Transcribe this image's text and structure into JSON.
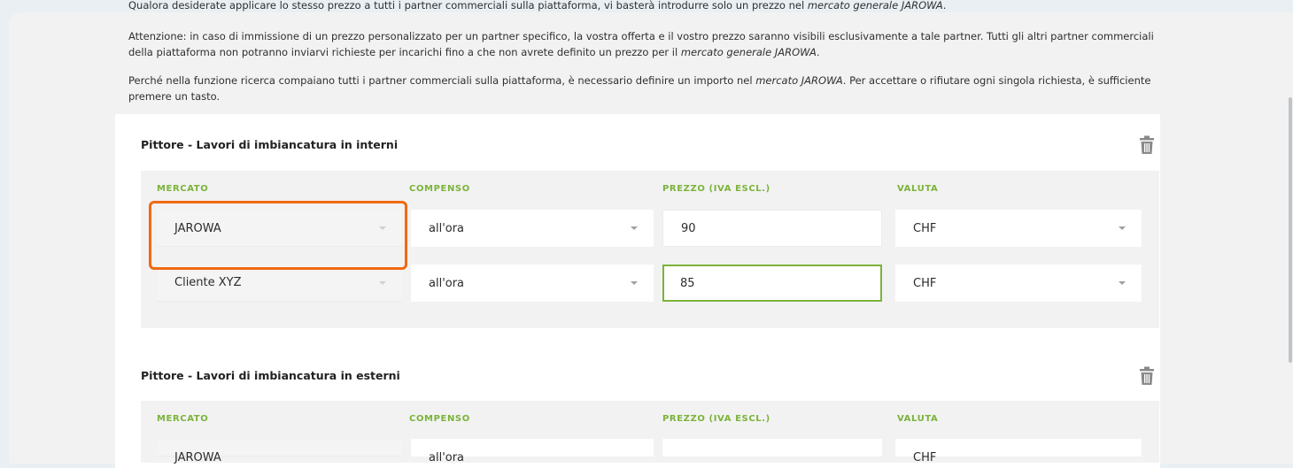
{
  "intro": {
    "p0": "Qualora desiderate applicare lo stesso prezzo a tutti i partner commerciali sulla piattaforma, vi basterà introdurre solo un prezzo nel mercato generale JAROWA.",
    "p1": "Attenzione: in caso di immissione di un prezzo personalizzato per un partner specifico, la vostra offerta e il vostro prezzo saranno visibili esclusivamente a tale partner. Tutti gli altri partner commerciali della piattaforma non potranno inviarvi richieste per incarichi fino a che non avrete definito un prezzo per il mercato generale JAROWA.",
    "p2": "Perché nella funzione ricerca compaiano tutti i partner commerciali sulla piattaforma, è necessario definire un importo nel mercato JAROWA. Per accettare o rifiutare ogni singola richiesta, è sufficiente premere un tasto."
  },
  "columns": {
    "market": "MERCATO",
    "compensation": "COMPENSO",
    "price": "PREZZO (IVA ESCL.)",
    "currency": "VALUTA"
  },
  "services": [
    {
      "title": "Pittore - Lavori di imbiancatura in interni",
      "rows": [
        {
          "market": "JAROWA",
          "compensation": "all'ora",
          "price": "90",
          "currency": "CHF"
        },
        {
          "market": "Cliente XYZ",
          "compensation": "all'ora",
          "price": "85",
          "currency": "CHF"
        }
      ]
    },
    {
      "title": "Pittore - Lavori di imbiancatura in esterni",
      "rows": [
        {
          "market": "JAROWA",
          "compensation": "all'ora",
          "price": "",
          "currency": "CHF"
        }
      ]
    }
  ],
  "icons": {
    "delete": "trash-icon",
    "dropdown": "chevron-down-icon"
  },
  "colors": {
    "accent": "#7bb33a",
    "highlight": "#f06a12"
  }
}
